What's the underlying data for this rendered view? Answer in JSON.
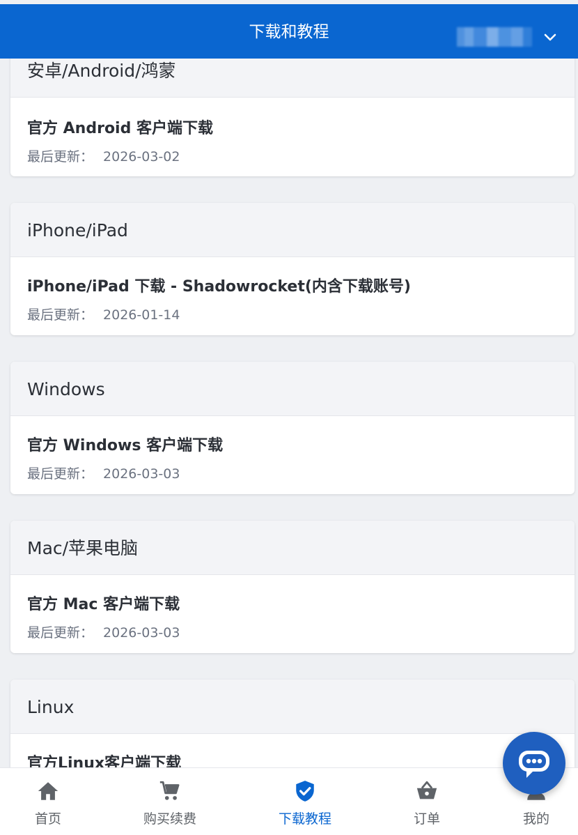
{
  "header": {
    "title": "下载和教程"
  },
  "sections": [
    {
      "category": "安卓/Android/鸿蒙",
      "item_title": "官方 Android 客户端下载",
      "meta_label": "最后更新：",
      "updated": "2026-03-02"
    },
    {
      "category": "iPhone/iPad",
      "item_title": "iPhone/iPad 下载 - Shadowrocket(内含下载账号)",
      "meta_label": "最后更新：",
      "updated": "2026-01-14"
    },
    {
      "category": "Windows",
      "item_title": "官方 Windows 客户端下载",
      "meta_label": "最后更新：",
      "updated": "2026-03-03"
    },
    {
      "category": "Mac/苹果电脑",
      "item_title": "官方 Mac 客户端下载",
      "meta_label": "最后更新：",
      "updated": "2026-03-03"
    },
    {
      "category": "Linux",
      "item_title": "官方Linux客户端下载"
    }
  ],
  "bottom_nav": [
    {
      "label": "首页",
      "icon": "home-icon"
    },
    {
      "label": "购买续费",
      "icon": "cart-icon"
    },
    {
      "label": "下载教程",
      "icon": "verified-shield-icon",
      "active": true
    },
    {
      "label": "订单",
      "icon": "basket-icon"
    },
    {
      "label": "我的",
      "icon": "user-icon"
    }
  ],
  "colors": {
    "primary": "#0a66d0",
    "fab": "#1f5fbf"
  }
}
